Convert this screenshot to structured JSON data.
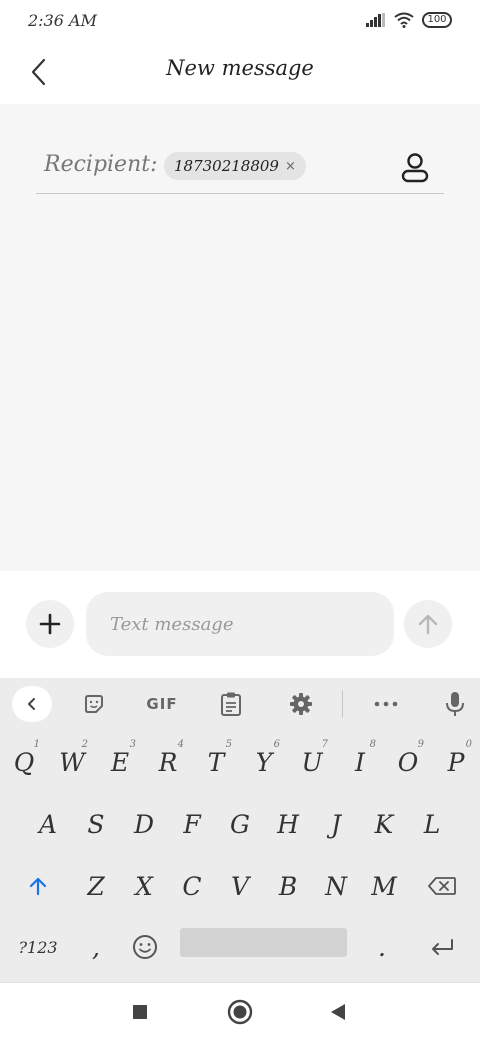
{
  "status_bar": {
    "time": "2:36 AM",
    "battery": "100"
  },
  "header": {
    "title": "New message"
  },
  "recipient": {
    "label": "Recipient:",
    "chip_number": "18730218809",
    "chip_close": "×"
  },
  "composer": {
    "placeholder": "Text message"
  },
  "keyboard": {
    "toolbar": {
      "gif_label": "GIF"
    },
    "row1": [
      {
        "key": "Q",
        "hint": "1"
      },
      {
        "key": "W",
        "hint": "2"
      },
      {
        "key": "E",
        "hint": "3"
      },
      {
        "key": "R",
        "hint": "4"
      },
      {
        "key": "T",
        "hint": "5"
      },
      {
        "key": "Y",
        "hint": "6"
      },
      {
        "key": "U",
        "hint": "7"
      },
      {
        "key": "I",
        "hint": "8"
      },
      {
        "key": "O",
        "hint": "9"
      },
      {
        "key": "P",
        "hint": "0"
      }
    ],
    "row2": [
      "A",
      "S",
      "D",
      "F",
      "G",
      "H",
      "J",
      "K",
      "L"
    ],
    "row3": [
      "Z",
      "X",
      "C",
      "V",
      "B",
      "N",
      "M"
    ],
    "row4": {
      "symbols": "?123",
      "comma": ",",
      "period": "."
    }
  },
  "colors": {
    "shift_accent": "#1a73e8",
    "content_bg": "#f6f6f6",
    "keyboard_bg": "#ececec"
  }
}
